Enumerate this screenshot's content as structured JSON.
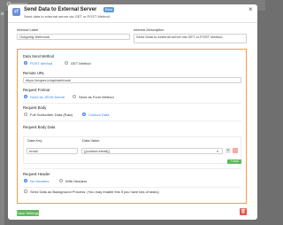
{
  "background": {
    "hint_icon": "gear-icon"
  },
  "modal": {
    "title": "Send Data to External Server",
    "badge": "Beta",
    "subtitle": "Send data to external server via GET or POST Method",
    "close_icon": "close-icon"
  },
  "internal_label": {
    "label": "Internal Label",
    "value": "Outgoing Webhook"
  },
  "internal_description": {
    "label": "Internal Description",
    "value": "Send Data to external server via GET or POST Method"
  },
  "data_send_method": {
    "label": "Data Send Method",
    "options": [
      "POST Method",
      "GET Method"
    ],
    "selected": "POST Method"
  },
  "remote_url": {
    "label": "Remote URL",
    "value": "https://reqres.in/api/webhook"
  },
  "request_format": {
    "label": "Request Format",
    "options": [
      "Send as JSON format",
      "Send as Form Method"
    ],
    "selected": "Send as JSON format"
  },
  "request_body": {
    "label": "Request Body",
    "options": [
      "Full Subscriber Data (Raw)",
      "Custom Data"
    ],
    "selected": "Custom Data"
  },
  "request_body_data": {
    "label": "Request Body Data",
    "columns": [
      "Data Key",
      "Data Value"
    ],
    "rows": [
      {
        "key": "email",
        "value": "{{contact.email}}"
      }
    ],
    "add_more": "+ Add More"
  },
  "request_header": {
    "label": "Request Header",
    "options": [
      "No Headers",
      "With Headers"
    ],
    "selected": "No Headers"
  },
  "background_process": {
    "label": "Send Data as Background Process. (You may enable this if you have lots of tasks)"
  },
  "footer": {
    "save": "Save Settings",
    "delete_icon": "trash-icon"
  },
  "colors": {
    "accent": "#3b82f6",
    "panel_border": "#ff9a3d",
    "save": "#5fb85c",
    "delete": "#e0534a"
  }
}
